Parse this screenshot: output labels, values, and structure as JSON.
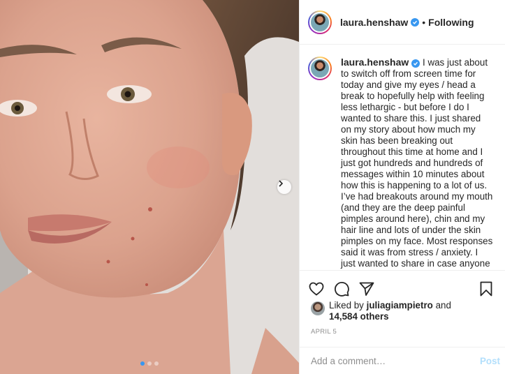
{
  "post": {
    "username": "laura.henshaw",
    "separator": "•",
    "follow_status": "Following",
    "caption": "I was just about to switch off from screen time for today and give my eyes / head a break to hopefully help with feeling less lethargic - but before I do I wanted to share this. I just shared on my story about how much my skin has been breaking out throughout this time at home and I just got hundreds and hundreds of messages within 10 minutes about how this is happening to a lot of us. I’ve had breakouts around my mouth (and they are the deep painful pimples around here), chin and my hair line and lots of under the skin pimples on my face. Most responses said it was from stress / anxiety. I just wanted to share in case anyone",
    "liked_by_prefix": "Liked by",
    "liked_by_user": "juliagiampietro",
    "liked_by_and": "and",
    "likes_count": "14,584 others",
    "date": "APRIL 5",
    "comment_placeholder": "Add a comment…",
    "post_label": "Post",
    "carousel": {
      "slides": 3,
      "active_index": 0
    }
  },
  "icons": {
    "like": "heart-icon",
    "comment": "comment-icon",
    "share": "paper-plane-icon",
    "save": "bookmark-icon",
    "next": "chevron-right-icon",
    "verified": "verified-badge-icon"
  },
  "colors": {
    "accent": "#3897f0",
    "post_disabled": "#b2dffc",
    "meta": "#8e8e8e",
    "text": "#262626"
  }
}
